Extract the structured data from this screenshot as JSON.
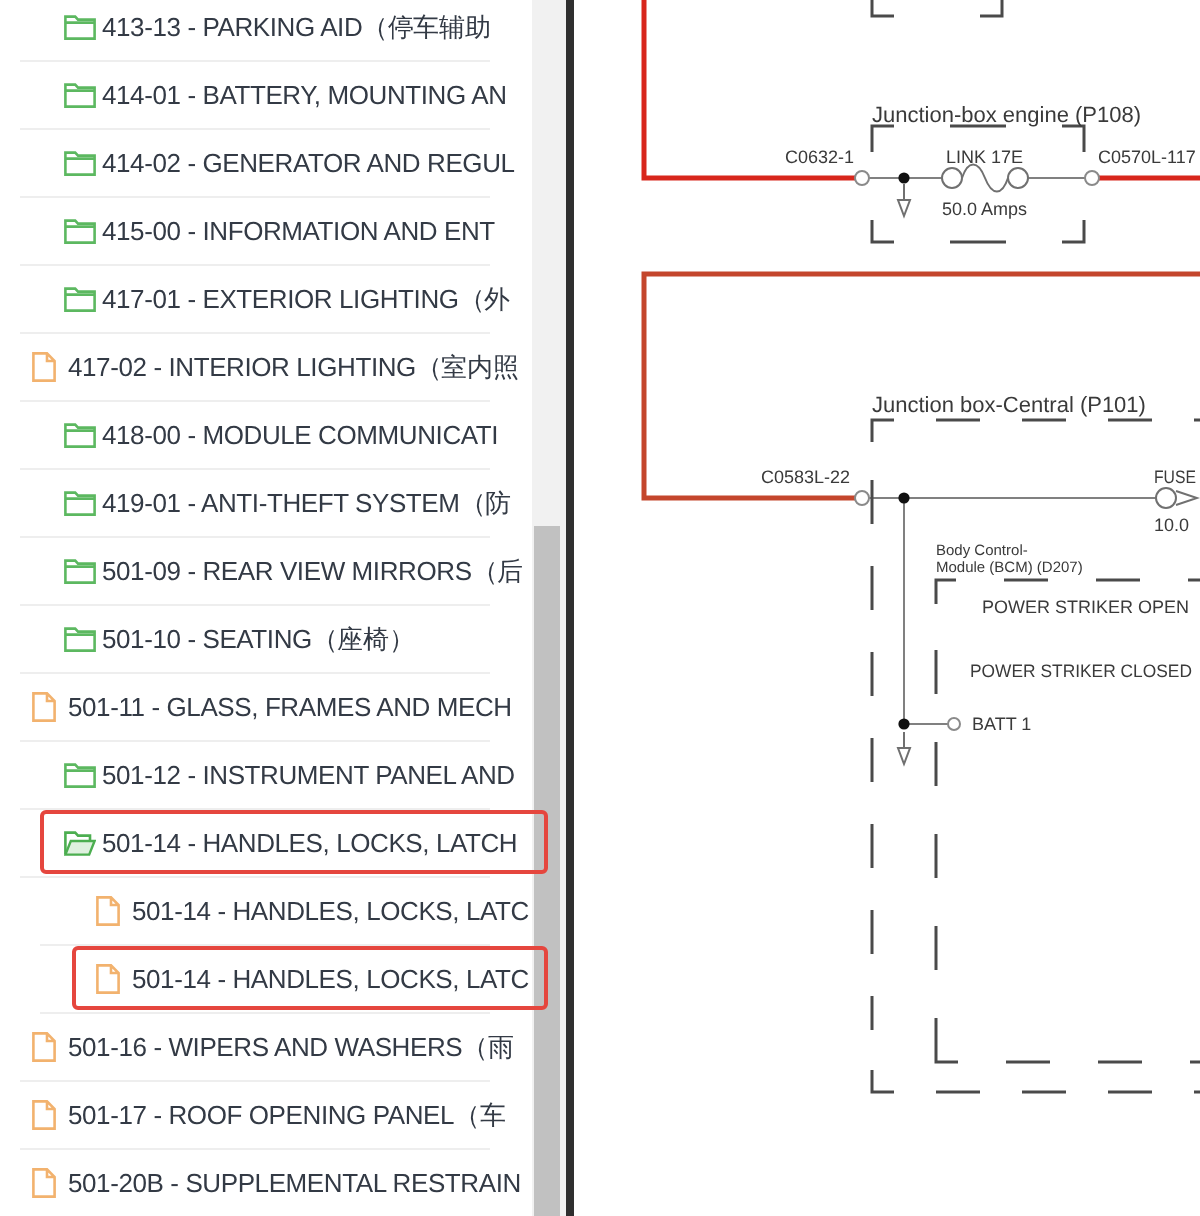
{
  "tree": {
    "items": [
      {
        "kind": "folder",
        "label": "413-13 - PARKING AID（停车辅助",
        "expanded": false,
        "highlighted": false
      },
      {
        "kind": "folder",
        "label": "414-01 - BATTERY, MOUNTING AN",
        "expanded": false,
        "highlighted": false
      },
      {
        "kind": "folder",
        "label": "414-02 - GENERATOR AND REGUL",
        "expanded": false,
        "highlighted": false
      },
      {
        "kind": "folder",
        "label": "415-00 - INFORMATION AND ENT",
        "expanded": false,
        "highlighted": false
      },
      {
        "kind": "folder",
        "label": "417-01 - EXTERIOR LIGHTING（外",
        "expanded": false,
        "highlighted": false
      },
      {
        "kind": "file",
        "label": "417-02 - INTERIOR LIGHTING（室内照",
        "highlighted": false
      },
      {
        "kind": "folder",
        "label": "418-00 - MODULE COMMUNICATI",
        "expanded": false,
        "highlighted": false
      },
      {
        "kind": "folder",
        "label": "419-01 - ANTI-THEFT SYSTEM（防",
        "expanded": false,
        "highlighted": false
      },
      {
        "kind": "folder",
        "label": "501-09 - REAR VIEW MIRRORS（后",
        "expanded": false,
        "highlighted": false
      },
      {
        "kind": "folder",
        "label": "501-10 - SEATING（座椅）",
        "expanded": false,
        "highlighted": false
      },
      {
        "kind": "file",
        "label": "501-11 - GLASS, FRAMES AND MECH",
        "highlighted": false
      },
      {
        "kind": "folder",
        "label": "501-12 - INSTRUMENT PANEL AND",
        "expanded": false,
        "highlighted": false
      },
      {
        "kind": "folder",
        "label": "501-14 - HANDLES, LOCKS, LATCH",
        "expanded": true,
        "highlighted": true,
        "children": [
          {
            "kind": "file",
            "label": "501-14 - HANDLES, LOCKS, LATC",
            "highlighted": false
          },
          {
            "kind": "file",
            "label": "501-14 - HANDLES, LOCKS, LATC",
            "highlighted": true
          }
        ]
      },
      {
        "kind": "file",
        "label": "501-16 - WIPERS AND WASHERS（雨",
        "highlighted": false
      },
      {
        "kind": "file",
        "label": "501-17 - ROOF OPENING PANEL（车",
        "highlighted": false
      },
      {
        "kind": "file",
        "label": "501-20B - SUPPLEMENTAL RESTRAIN",
        "highlighted": false
      }
    ]
  },
  "diagram": {
    "engine_box": {
      "title": "Junction-box engine (P108)",
      "connector_in": "C0632-1",
      "fuse_name": "LINK 17E",
      "connector_out": "C0570L-117",
      "fuse_rating": "50.0 Amps"
    },
    "central_box": {
      "title": "Junction box-Central (P101)",
      "connector_in": "C0583L-22",
      "fuse_name": "FUSE",
      "fuse_rating": "10.0",
      "module": {
        "title_lines": [
          "Body Control-",
          "Module (BCM) (D207)"
        ],
        "pins": [
          "POWER STRIKER OPEN",
          "POWER STRIKER CLOSED"
        ]
      },
      "terminal": "BATT 1"
    }
  }
}
